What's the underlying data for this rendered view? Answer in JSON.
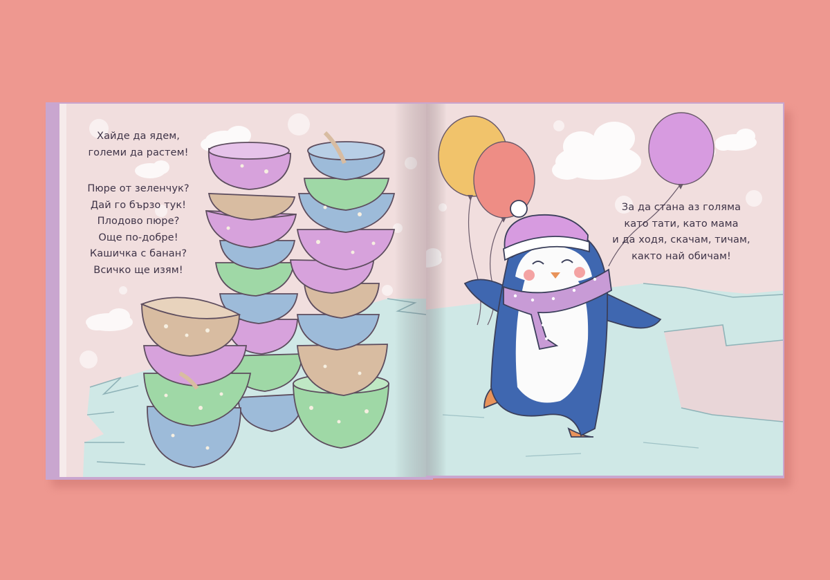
{
  "colors": {
    "background": "#ee9890",
    "page": "#f1dede",
    "cover": "#c9a6cf",
    "ice": "#cfe8e6",
    "ink": "#3e3347",
    "bowl_purple": "#d7a2dc",
    "bowl_blue": "#9dbbd9",
    "bowl_green": "#9fd8a6",
    "bowl_tan": "#d8bca1",
    "balloon_yellow": "#f1c36b",
    "balloon_coral": "#ee8d85",
    "balloon_purple": "#d79be0",
    "penguin_blue": "#3f67b0",
    "scarf": "#c89bd6"
  },
  "book": {
    "left_page": {
      "stanza_1": [
        "Хайде да ядем,",
        "големи да растем!"
      ],
      "stanza_2": [
        "Пюре от зеленчук?",
        "Дай го бързо тук!",
        "Плодово пюре?",
        "Още по-добре!",
        "Кашичка с банан?",
        "Всичко ще изям!"
      ]
    },
    "right_page": {
      "stanza": [
        "За да стана аз голяма",
        "като тати, като мама",
        "и да ходя, скачам, тичам,",
        "както най обичам!"
      ]
    }
  },
  "illustration": {
    "left": [
      "stacked-bowls",
      "clouds",
      "ice-floe"
    ],
    "right": [
      "penguin",
      "balloons",
      "clouds",
      "ice-floe"
    ]
  }
}
